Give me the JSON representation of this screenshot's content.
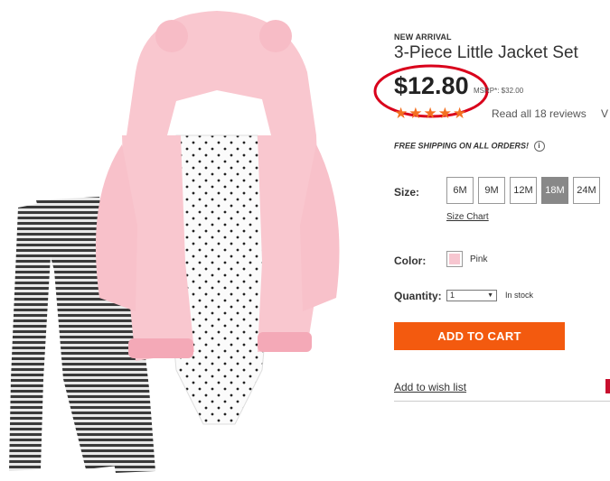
{
  "product": {
    "badge": "NEW ARRIVAL",
    "title": "3-Piece Little Jacket Set",
    "price": "$12.80",
    "msrp": "MSRP*: $32.00",
    "rating": {
      "stars": "★★★★★",
      "value": 5,
      "max": 5
    },
    "reviews_link": "Read all 18 reviews",
    "reviews_cut": "V",
    "shipping": "FREE SHIPPING ON ALL ORDERS!",
    "shipping_info_icon": "i"
  },
  "options": {
    "size_label": "Size:",
    "sizes": [
      "6M",
      "9M",
      "12M",
      "18M",
      "24M"
    ],
    "selected_size": "18M",
    "size_chart_link": "Size Chart",
    "color_label": "Color:",
    "color_name": "Pink",
    "color_hex": "#f7c6d0",
    "quantity_label": "Quantity:",
    "quantity_value": "1",
    "quantity_arrow": "▼",
    "stock_status": "In stock"
  },
  "actions": {
    "add_to_cart": "ADD TO CART",
    "wishlist": "Add to wish list"
  },
  "colors": {
    "accent": "#f35a0f",
    "stars": "#f37021",
    "highlight_circle": "#d9001b"
  }
}
